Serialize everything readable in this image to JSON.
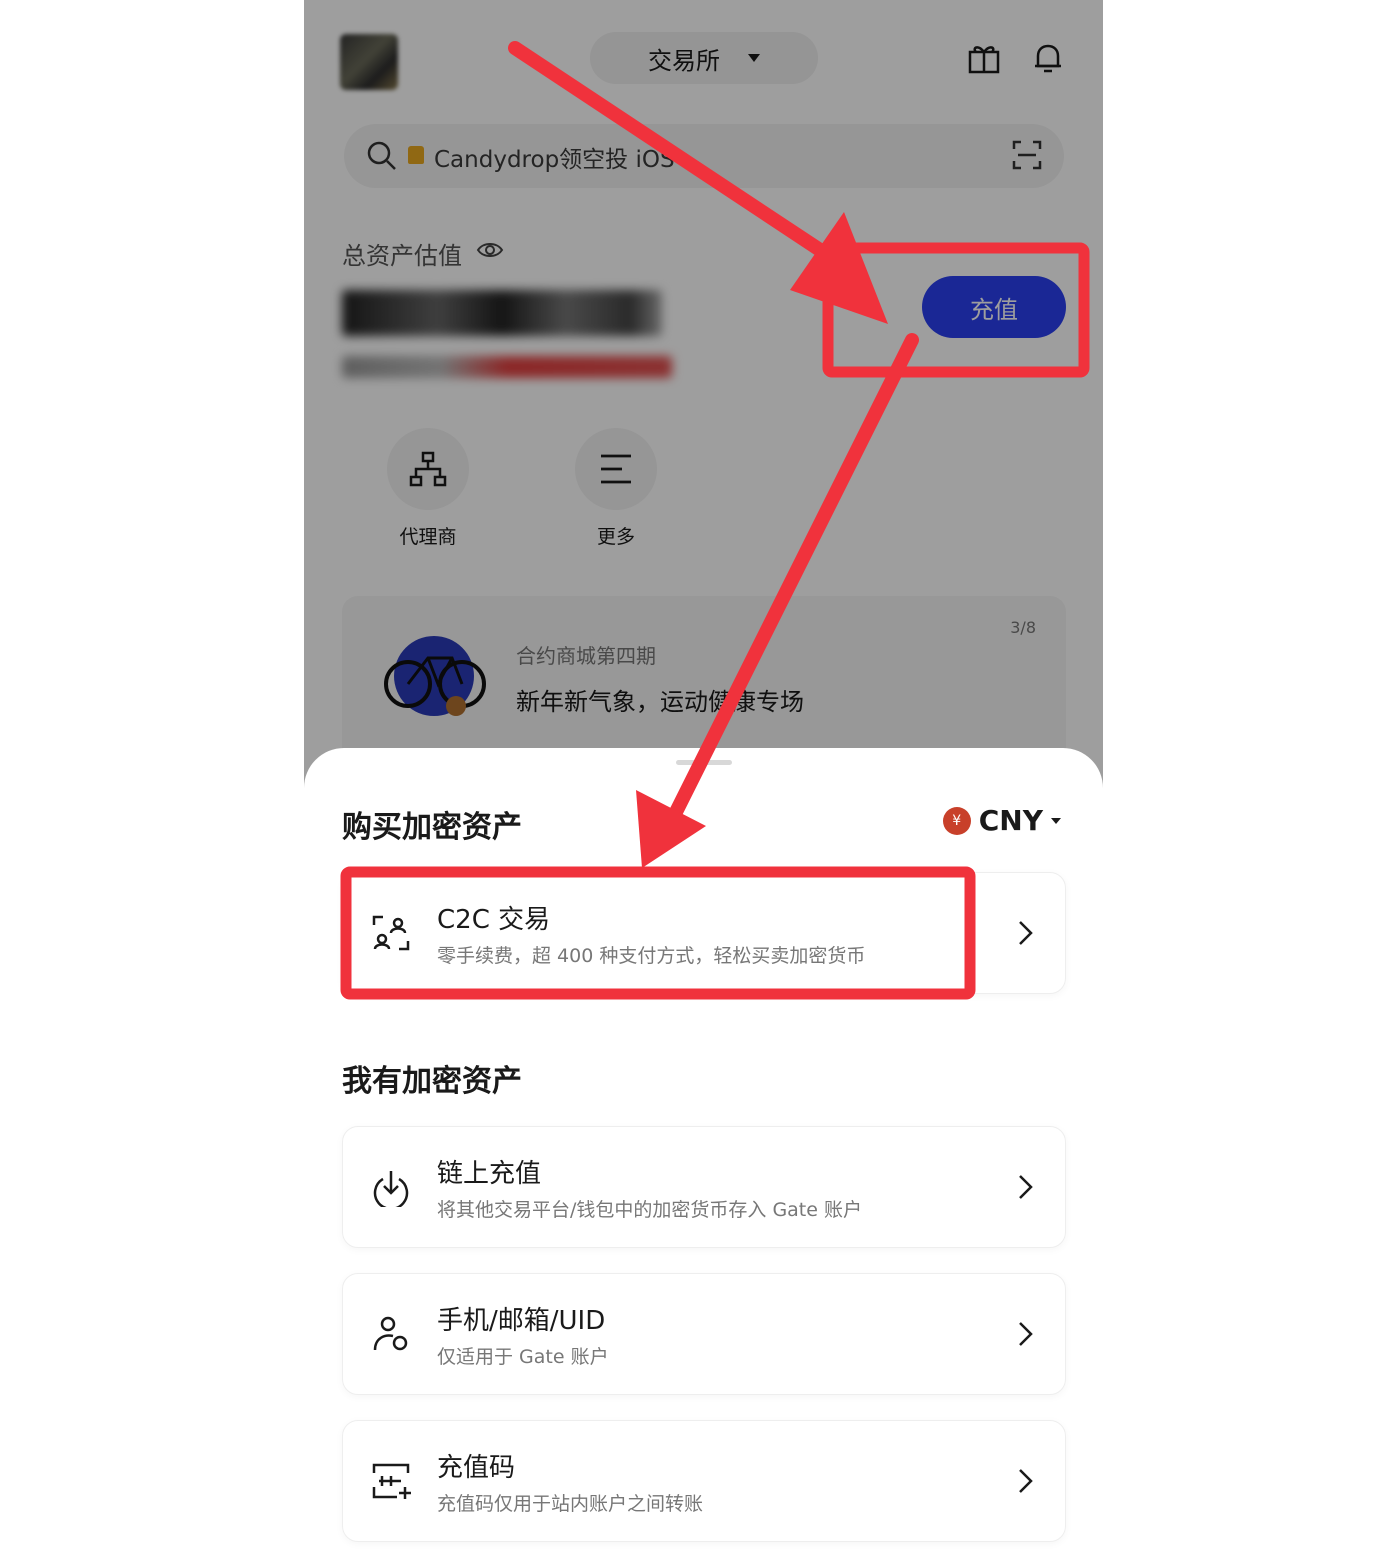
{
  "header": {
    "exchange_label": "交易所"
  },
  "search": {
    "placeholder": "Candydrop领空投 iOS"
  },
  "assets": {
    "label": "总资产估值",
    "deposit_button": "充值"
  },
  "shortcuts": [
    {
      "label": "代理商",
      "icon": "org-chart-icon"
    },
    {
      "label": "更多",
      "icon": "menu-lines-icon"
    }
  ],
  "promo": {
    "page_indicator": "3/8",
    "subtitle": "合约商城第四期",
    "title": "新年新气象，运动健康专场"
  },
  "sheet": {
    "buy_title": "购买加密资产",
    "currency": {
      "symbol": "¥",
      "code": "CNY"
    },
    "have_title": "我有加密资产",
    "options": [
      {
        "title": "C2C 交易",
        "desc": "零手续费，超 400 种支付方式，轻松买卖加密货币",
        "icon": "c2c-exchange-icon"
      },
      {
        "title": "链上充值",
        "desc": "将其他交易平台/钱包中的加密货币存入 Gate 账户",
        "icon": "download-circle-icon"
      },
      {
        "title": "手机/邮箱/UID",
        "desc": "仅适用于 Gate 账户",
        "icon": "user-transfer-icon"
      },
      {
        "title": "充值码",
        "desc": "充值码仅用于站内账户之间转账",
        "icon": "code-plus-icon"
      }
    ]
  },
  "colors": {
    "accent": "#2a3ff0",
    "annotation_red": "#f0323c",
    "currency_coin": "#c8402a"
  }
}
